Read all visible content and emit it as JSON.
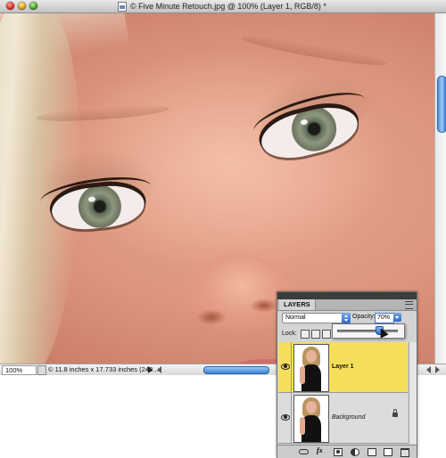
{
  "window": {
    "title": "Five Minute Retouch.jpg @ 100% (Layer 1, RGB/8) *",
    "title_prefix": "©"
  },
  "status_bar": {
    "zoom": "100%",
    "doc_info": "11.8 inches x 17.733 inches (240..."
  },
  "layers_panel": {
    "tab_label": "LAYERS",
    "blend_mode": "Normal",
    "opacity_label": "Opacity:",
    "opacity_value": "70%",
    "opacity_fraction": 0.7,
    "lock_label": "Lock:",
    "layers": [
      {
        "name": "Layer 1",
        "selected": true,
        "visible": true
      },
      {
        "name": "Background",
        "selected": false,
        "visible": true,
        "locked": true
      }
    ]
  },
  "colors": {
    "selected_layer": "#f6de5a",
    "accent": "#2d6bc4"
  },
  "icons": [
    "close-button",
    "minimize-button",
    "zoom-button",
    "document-icon",
    "eye-icon",
    "lock-icon",
    "link-icon",
    "fx-icon",
    "layer-mask-icon",
    "adjustment-layer-icon",
    "group-folder-icon",
    "new-layer-icon",
    "trash-icon",
    "panel-menu-icon"
  ]
}
